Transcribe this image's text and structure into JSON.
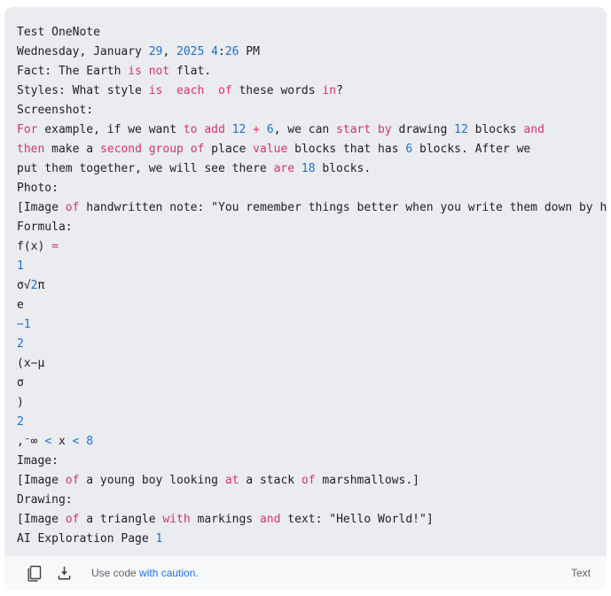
{
  "card": {
    "language_label": "Text",
    "footer": {
      "copy_icon": "copy-icon",
      "download_icon": "download-icon",
      "caution_prefix": "Use code ",
      "caution_link": "with caution."
    }
  },
  "code": {
    "lines": [
      [
        {
          "t": "Test OneNote",
          "c": "plain"
        }
      ],
      [
        {
          "t": "Wednesday, January ",
          "c": "plain"
        },
        {
          "t": "29",
          "c": "num"
        },
        {
          "t": ", ",
          "c": "plain"
        },
        {
          "t": "2025",
          "c": "num"
        },
        {
          "t": " ",
          "c": "plain"
        },
        {
          "t": "4",
          "c": "num"
        },
        {
          "t": ":",
          "c": "plain"
        },
        {
          "t": "26",
          "c": "num"
        },
        {
          "t": " PM",
          "c": "plain"
        }
      ],
      [
        {
          "t": "Fact: The Earth ",
          "c": "plain"
        },
        {
          "t": "is",
          "c": "kw"
        },
        {
          "t": " ",
          "c": "plain"
        },
        {
          "t": "not",
          "c": "kw"
        },
        {
          "t": " flat.",
          "c": "plain"
        }
      ],
      [
        {
          "t": "Styles: What style ",
          "c": "plain"
        },
        {
          "t": "is",
          "c": "kw"
        },
        {
          "t": "  ",
          "c": "plain"
        },
        {
          "t": "each",
          "c": "kw"
        },
        {
          "t": "  ",
          "c": "plain"
        },
        {
          "t": "of",
          "c": "kw"
        },
        {
          "t": " these words ",
          "c": "plain"
        },
        {
          "t": "in",
          "c": "kw"
        },
        {
          "t": "?",
          "c": "plain"
        }
      ],
      [
        {
          "t": "Screenshot:",
          "c": "plain"
        }
      ],
      [
        {
          "t": "For",
          "c": "kw"
        },
        {
          "t": " example, if we want ",
          "c": "plain"
        },
        {
          "t": "to",
          "c": "kw"
        },
        {
          "t": " ",
          "c": "plain"
        },
        {
          "t": "add",
          "c": "kw"
        },
        {
          "t": " ",
          "c": "plain"
        },
        {
          "t": "12",
          "c": "num"
        },
        {
          "t": " ",
          "c": "plain"
        },
        {
          "t": "+",
          "c": "op"
        },
        {
          "t": " ",
          "c": "plain"
        },
        {
          "t": "6",
          "c": "num"
        },
        {
          "t": ", we can ",
          "c": "plain"
        },
        {
          "t": "start",
          "c": "kw"
        },
        {
          "t": " ",
          "c": "plain"
        },
        {
          "t": "by",
          "c": "kw"
        },
        {
          "t": " drawing ",
          "c": "plain"
        },
        {
          "t": "12",
          "c": "num"
        },
        {
          "t": " blocks ",
          "c": "plain"
        },
        {
          "t": "and",
          "c": "kw"
        }
      ],
      [
        {
          "t": "then",
          "c": "kw"
        },
        {
          "t": " make a ",
          "c": "plain"
        },
        {
          "t": "second",
          "c": "kw"
        },
        {
          "t": " ",
          "c": "plain"
        },
        {
          "t": "group",
          "c": "kw"
        },
        {
          "t": " ",
          "c": "plain"
        },
        {
          "t": "of",
          "c": "kw"
        },
        {
          "t": " place ",
          "c": "plain"
        },
        {
          "t": "value",
          "c": "kw"
        },
        {
          "t": " blocks that has ",
          "c": "plain"
        },
        {
          "t": "6",
          "c": "num"
        },
        {
          "t": " blocks. After we",
          "c": "plain"
        }
      ],
      [
        {
          "t": "put them together, we will see there ",
          "c": "plain"
        },
        {
          "t": "are",
          "c": "kw"
        },
        {
          "t": " ",
          "c": "plain"
        },
        {
          "t": "18",
          "c": "num"
        },
        {
          "t": " blocks.",
          "c": "plain"
        }
      ],
      [
        {
          "t": "Photo:",
          "c": "plain"
        }
      ],
      [
        {
          "t": "[Image ",
          "c": "plain"
        },
        {
          "t": "of",
          "c": "kw"
        },
        {
          "t": " handwritten note: \"You remember things better when you write them down by hand.\"]",
          "c": "plain"
        }
      ],
      [
        {
          "t": "Formula:",
          "c": "plain"
        }
      ],
      [
        {
          "t": "f(x) ",
          "c": "plain"
        },
        {
          "t": "=",
          "c": "op"
        }
      ],
      [
        {
          "t": "1",
          "c": "num"
        }
      ],
      [
        {
          "t": "σ√",
          "c": "plain"
        },
        {
          "t": "2",
          "c": "num"
        },
        {
          "t": "π",
          "c": "plain"
        }
      ],
      [
        {
          "t": "e",
          "c": "plain"
        }
      ],
      [
        {
          "t": "−1",
          "c": "num"
        }
      ],
      [
        {
          "t": "2",
          "c": "num"
        }
      ],
      [
        {
          "t": "(x−µ",
          "c": "plain"
        }
      ],
      [
        {
          "t": "σ",
          "c": "plain"
        }
      ],
      [
        {
          "t": ")",
          "c": "plain"
        }
      ],
      [
        {
          "t": "2",
          "c": "num"
        }
      ],
      [
        {
          "t": ",⁻∞ ",
          "c": "plain"
        },
        {
          "t": "<",
          "c": "cmp"
        },
        {
          "t": " x ",
          "c": "plain"
        },
        {
          "t": "<",
          "c": "cmp"
        },
        {
          "t": " ",
          "c": "plain"
        },
        {
          "t": "8",
          "c": "num"
        }
      ],
      [
        {
          "t": "Image:",
          "c": "plain"
        }
      ],
      [
        {
          "t": "[Image ",
          "c": "plain"
        },
        {
          "t": "of",
          "c": "kw"
        },
        {
          "t": " a young boy looking ",
          "c": "plain"
        },
        {
          "t": "at",
          "c": "kw"
        },
        {
          "t": " a stack ",
          "c": "plain"
        },
        {
          "t": "of",
          "c": "kw"
        },
        {
          "t": " marshmallows.]",
          "c": "plain"
        }
      ],
      [
        {
          "t": "Drawing:",
          "c": "plain"
        }
      ],
      [
        {
          "t": "[Image ",
          "c": "plain"
        },
        {
          "t": "of",
          "c": "kw"
        },
        {
          "t": " a triangle ",
          "c": "plain"
        },
        {
          "t": "with",
          "c": "kw"
        },
        {
          "t": " markings ",
          "c": "plain"
        },
        {
          "t": "and",
          "c": "kw"
        },
        {
          "t": " text: \"Hello World!\"]",
          "c": "plain"
        }
      ],
      [
        {
          "t": "AI Exploration Page ",
          "c": "plain"
        },
        {
          "t": "1",
          "c": "num"
        }
      ]
    ]
  },
  "colors": {
    "code_background": "#eaecf0",
    "footer_background": "#f8f9fa",
    "keyword": "#d6336c",
    "number": "#1a6fd4",
    "text": "#202124",
    "link": "#1a73e8",
    "muted": "#5f6368"
  }
}
